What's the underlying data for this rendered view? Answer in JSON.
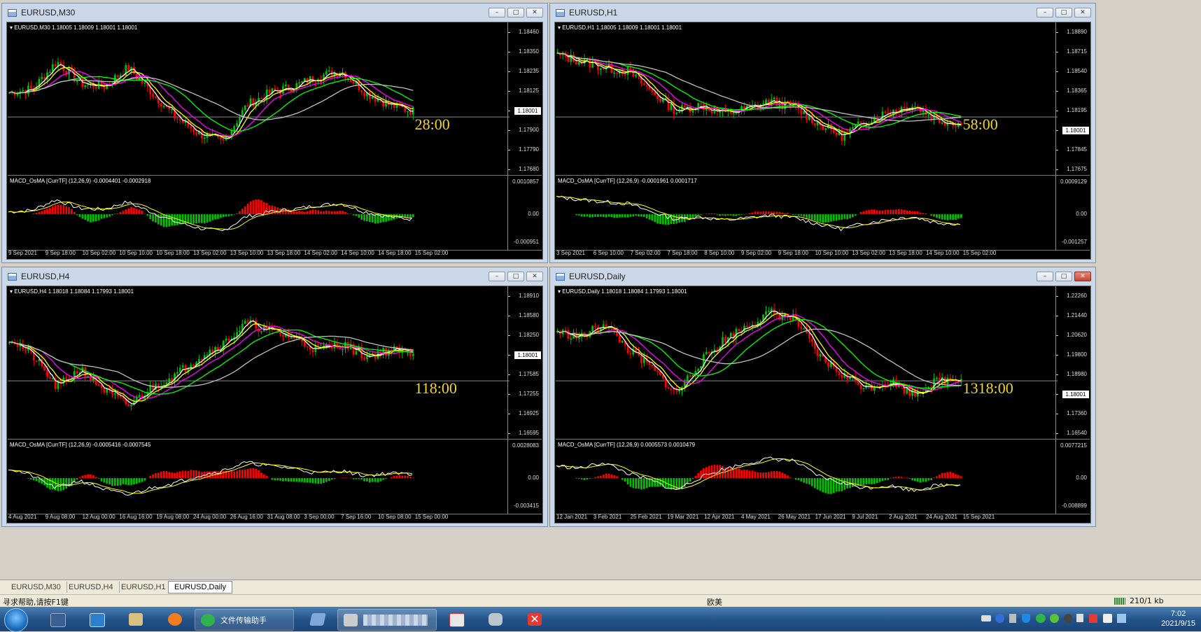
{
  "windows": {
    "m30": {
      "title": "EURUSD,M30",
      "header": "EURUSD,M30  1.18005 1.18009 1.18001 1.18001",
      "macd_header": "MACD_OsMA [CurrTF] (12,26,9) -0.0004401 -0.0002918",
      "price_ticks": [
        "1.18460",
        "1.18350",
        "1.18235",
        "1.18125",
        "1.18001",
        "1.17900",
        "1.17790",
        "1.17680"
      ],
      "macd_ticks": [
        "0.0010857",
        "0.00",
        "-0.000951"
      ],
      "current_price": "1.18001",
      "countdown": "28:00",
      "x_labels": [
        "9 Sep 2021",
        "9 Sep 18:00",
        "10 Sep 02:00",
        "10 Sep 10:00",
        "10 Sep 18:00",
        "13 Sep 02:00",
        "13 Sep 10:00",
        "13 Sep 18:00",
        "14 Sep 02:00",
        "14 Sep 10:00",
        "14 Sep 18:00",
        "15 Sep 02:00"
      ]
    },
    "h1": {
      "title": "EURUSD,H1",
      "header": "EURUSD,H1  1.18005 1.18009 1.18001 1.18001",
      "macd_header": "MACD_OsMA [CurrTF] (12,26,9) -0.0001961 0.0001717",
      "price_ticks": [
        "1.18890",
        "1.18715",
        "1.18540",
        "1.18365",
        "1.18195",
        "1.18001",
        "1.17845",
        "1.17675"
      ],
      "macd_ticks": [
        "0.0009129",
        "0.00",
        "-0.001257"
      ],
      "current_price": "1.18001",
      "countdown": "58:00",
      "x_labels": [
        "3 Sep 2021",
        "6 Sep 10:00",
        "7 Sep 02:00",
        "7 Sep 18:00",
        "8 Sep 10:00",
        "9 Sep 02:00",
        "9 Sep 18:00",
        "10 Sep 10:00",
        "13 Sep 02:00",
        "13 Sep 18:00",
        "14 Sep 10:00",
        "15 Sep 02:00"
      ]
    },
    "h4": {
      "title": "EURUSD,H4",
      "header": "EURUSD,H4  1.18018 1.18084 1.17993 1.18001",
      "macd_header": "MACD_OsMA [CurrTF] (12,26,9) -0.0005416 -0.0007545",
      "price_ticks": [
        "1.18910",
        "1.18580",
        "1.18250",
        "1.18001",
        "1.17585",
        "1.17255",
        "1.16925",
        "1.16595"
      ],
      "macd_ticks": [
        "0.0028083",
        "0.00",
        "-0.003415"
      ],
      "current_price": "1.18001",
      "countdown": "118:00",
      "x_labels": [
        "4 Aug 2021",
        "9 Aug 08:00",
        "12 Aug 00:00",
        "16 Aug 16:00",
        "19 Aug 08:00",
        "24 Aug 00:00",
        "26 Aug 16:00",
        "31 Aug 08:00",
        "3 Sep 00:00",
        "7 Sep 16:00",
        "10 Sep 08:00",
        "15 Sep 00:00"
      ]
    },
    "daily": {
      "title": "EURUSD,Daily",
      "header": "EURUSD,Daily  1.18018 1.18084 1.17993 1.18001",
      "macd_header": "MACD_OsMA [CurrTF] (12,26,9) 0.0005573 0.0010479",
      "price_ticks": [
        "1.22260",
        "1.21440",
        "1.20620",
        "1.19800",
        "1.18980",
        "1.18001",
        "1.17360",
        "1.16540"
      ],
      "macd_ticks": [
        "0.0077215",
        "0.00",
        "-0.008899"
      ],
      "current_price": "1.18001",
      "countdown": "1318:00",
      "x_labels": [
        "12 Jan 2021",
        "3 Feb 2021",
        "25 Feb 2021",
        "19 Mar 2021",
        "12 Apr 2021",
        "4 May 2021",
        "26 May 2021",
        "17 Jun 2021",
        "9 Jul 2021",
        "2 Aug 2021",
        "24 Aug 2021",
        "15 Sep 2021"
      ]
    }
  },
  "tabs": [
    "EURUSD,M30",
    "EURUSD,H4",
    "EURUSD,H1",
    "EURUSD,Daily"
  ],
  "active_tab": "EURUSD,Daily",
  "status": {
    "help": "寻求帮助,请按F1键",
    "profile": "欧美",
    "traffic": "210/1 kb"
  },
  "taskbar": {
    "wechat_label": "文件传输助手",
    "time": "7:02",
    "date": "2021/9/15"
  },
  "colors": {
    "bull": "#00c000",
    "bear": "#ff0000",
    "ma_white": "#ffffff",
    "ma_yellow": "#ffff00",
    "ma_magenta": "#ff00ff",
    "ma_green": "#00ff00",
    "ma_gray": "#c0c0c0",
    "countdown": "#f2d52b"
  }
}
